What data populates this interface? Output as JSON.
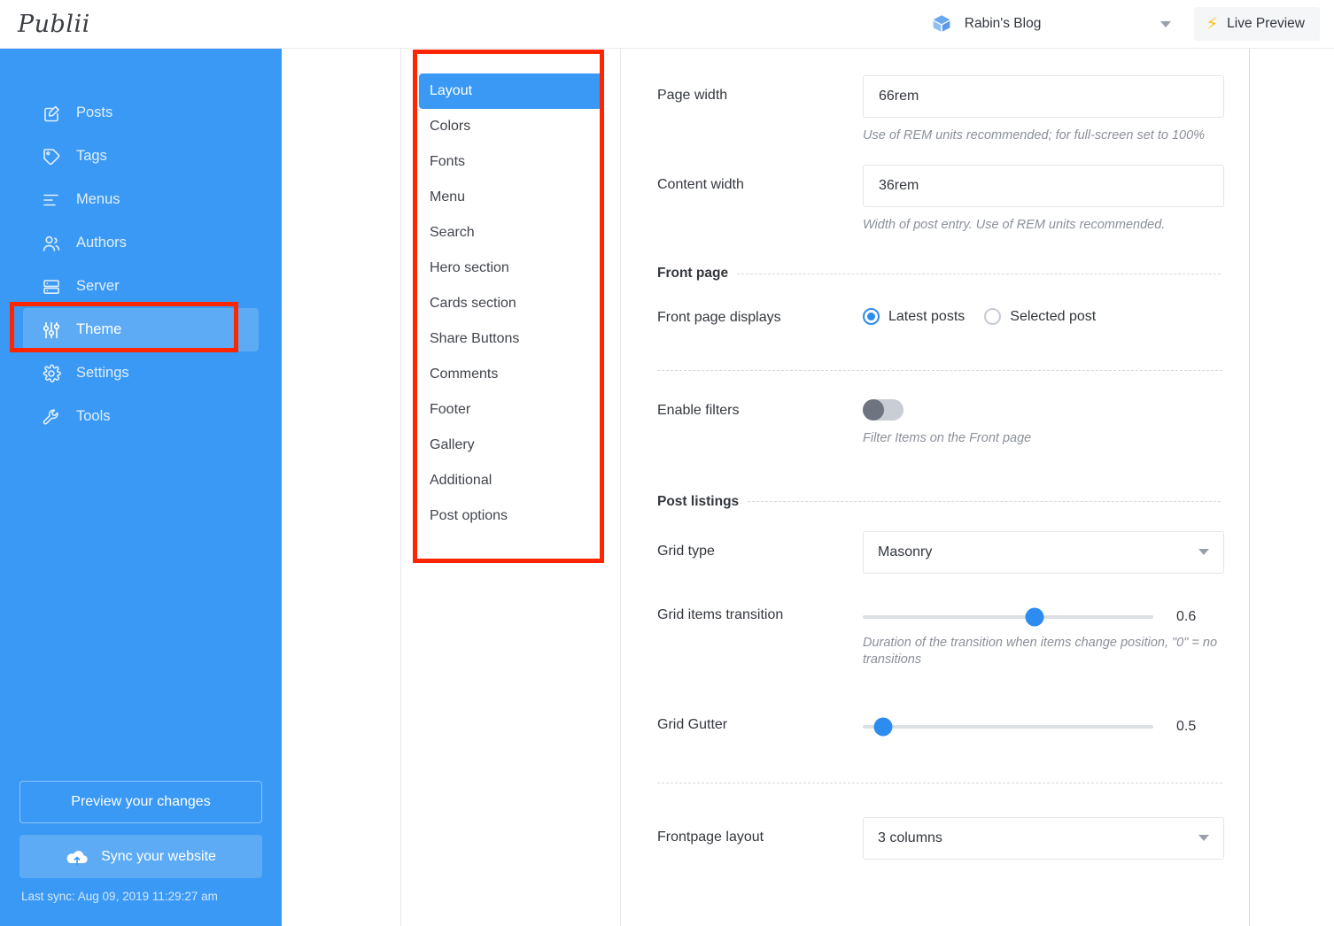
{
  "topbar": {
    "logo_text": "Publii",
    "site_name": "Rabin's Blog",
    "site_icon": "cube-icon",
    "dropdown_icon": "chevron-down-icon",
    "live_preview_label": "Live Preview",
    "live_preview_icon": "lightning-bolt-icon"
  },
  "sidebar": {
    "items": [
      {
        "label": "Posts",
        "icon": "edit-square-icon",
        "active": false
      },
      {
        "label": "Tags",
        "icon": "tag-icon",
        "active": false
      },
      {
        "label": "Menus",
        "icon": "list-icon",
        "active": false
      },
      {
        "label": "Authors",
        "icon": "users-icon",
        "active": false
      },
      {
        "label": "Server",
        "icon": "server-icon",
        "active": false
      },
      {
        "label": "Theme",
        "icon": "sliders-icon",
        "active": true
      },
      {
        "label": "Settings",
        "icon": "gear-icon",
        "active": false
      },
      {
        "label": "Tools",
        "icon": "wrench-icon",
        "active": false
      }
    ],
    "preview_button": "Preview your changes",
    "sync_button": "Sync your website",
    "sync_icon": "cloud-upload-icon",
    "last_sync": "Last sync: Aug 09, 2019 11:29:27 am"
  },
  "submenu": {
    "items": [
      {
        "label": "Layout",
        "active": true
      },
      {
        "label": "Colors",
        "active": false
      },
      {
        "label": "Fonts",
        "active": false
      },
      {
        "label": "Menu",
        "active": false
      },
      {
        "label": "Search",
        "active": false
      },
      {
        "label": "Hero section",
        "active": false
      },
      {
        "label": "Cards section",
        "active": false
      },
      {
        "label": "Share Buttons",
        "active": false
      },
      {
        "label": "Comments",
        "active": false
      },
      {
        "label": "Footer",
        "active": false
      },
      {
        "label": "Gallery",
        "active": false
      },
      {
        "label": "Additional",
        "active": false
      },
      {
        "label": "Post options",
        "active": false
      }
    ]
  },
  "main": {
    "page_width": {
      "label": "Page width",
      "value": "66rem",
      "hint": "Use of REM units recommended; for full-screen set to 100%"
    },
    "content_width": {
      "label": "Content width",
      "value": "36rem",
      "hint": "Width of post entry. Use of REM units recommended."
    },
    "front_page": {
      "section_title": "Front page",
      "displays_label": "Front page displays",
      "options": [
        {
          "label": "Latest posts",
          "selected": true
        },
        {
          "label": "Selected post",
          "selected": false
        }
      ],
      "enable_filters_label": "Enable filters",
      "enable_filters_on": false,
      "enable_filters_hint": "Filter Items on the Front page"
    },
    "post_listings": {
      "section_title": "Post listings",
      "grid_type_label": "Grid type",
      "grid_type_value": "Masonry",
      "grid_transition_label": "Grid items transition",
      "grid_transition_value": "0.6",
      "grid_transition_percent": 59,
      "grid_transition_hint": "Duration of the transition when items change position, \"0\" = no transitions",
      "grid_gutter_label": "Grid Gutter",
      "grid_gutter_value": "0.5",
      "grid_gutter_percent": 7,
      "frontpage_layout_label": "Frontpage layout",
      "frontpage_layout_value": "3 columns"
    }
  },
  "annotations": {
    "color": "#fe2600",
    "boxes": [
      "theme-sidebar-item",
      "theme-submenu-list"
    ]
  }
}
